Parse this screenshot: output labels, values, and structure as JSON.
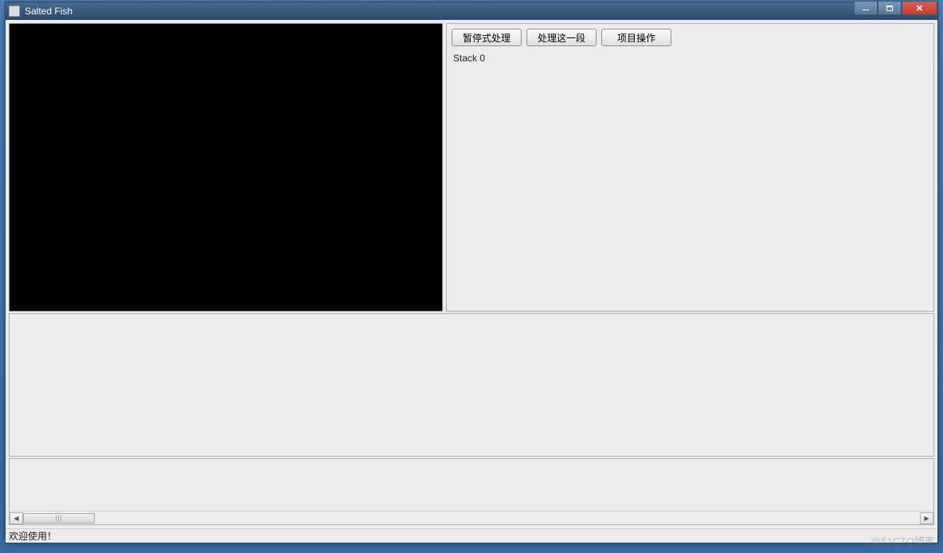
{
  "window": {
    "title": "Salted Fish"
  },
  "toolbar": {
    "buttons": [
      {
        "label": "暂停式处理"
      },
      {
        "label": "处理这一段"
      },
      {
        "label": "项目操作"
      }
    ]
  },
  "stack": {
    "text": "Stack 0"
  },
  "statusbar": {
    "text": "欢迎使用！"
  },
  "watermark": "@51CTO博客"
}
